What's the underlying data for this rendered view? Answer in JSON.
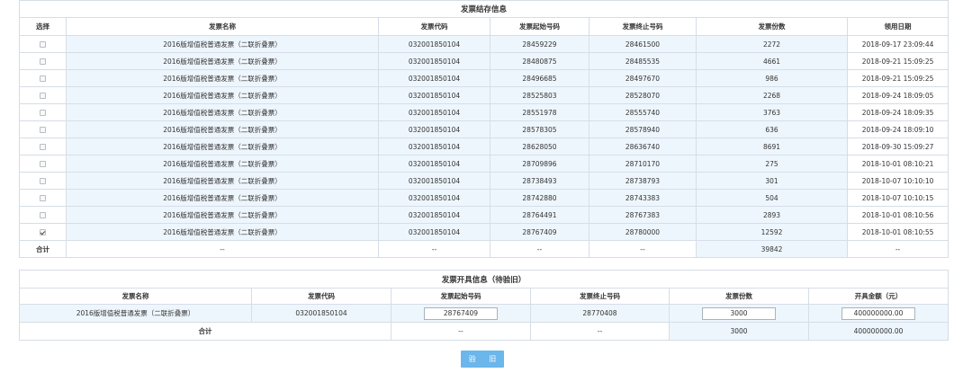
{
  "inventory": {
    "title": "发票结存信息",
    "headers": [
      "选择",
      "发票名称",
      "发票代码",
      "发票起始号码",
      "发票终止号码",
      "发票份数",
      "领用日期"
    ],
    "rows": [
      {
        "name": "2016版增值税普通发票（二联折叠票）",
        "code": "032001850104",
        "start": "28459229",
        "end": "28461500",
        "count": "2272",
        "date": "2018-09-17 23:09:44",
        "checked": false
      },
      {
        "name": "2016版增值税普通发票（二联折叠票）",
        "code": "032001850104",
        "start": "28480875",
        "end": "28485535",
        "count": "4661",
        "date": "2018-09-21 15:09:25",
        "checked": false
      },
      {
        "name": "2016版增值税普通发票（二联折叠票）",
        "code": "032001850104",
        "start": "28496685",
        "end": "28497670",
        "count": "986",
        "date": "2018-09-21 15:09:25",
        "checked": false
      },
      {
        "name": "2016版增值税普通发票（二联折叠票）",
        "code": "032001850104",
        "start": "28525803",
        "end": "28528070",
        "count": "2268",
        "date": "2018-09-24 18:09:05",
        "checked": false
      },
      {
        "name": "2016版增值税普通发票（二联折叠票）",
        "code": "032001850104",
        "start": "28551978",
        "end": "28555740",
        "count": "3763",
        "date": "2018-09-24 18:09:35",
        "checked": false
      },
      {
        "name": "2016版增值税普通发票（二联折叠票）",
        "code": "032001850104",
        "start": "28578305",
        "end": "28578940",
        "count": "636",
        "date": "2018-09-24 18:09:10",
        "checked": false
      },
      {
        "name": "2016版增值税普通发票（二联折叠票）",
        "code": "032001850104",
        "start": "28628050",
        "end": "28636740",
        "count": "8691",
        "date": "2018-09-30 15:09:27",
        "checked": false
      },
      {
        "name": "2016版增值税普通发票（二联折叠票）",
        "code": "032001850104",
        "start": "28709896",
        "end": "28710170",
        "count": "275",
        "date": "2018-10-01 08:10:21",
        "checked": false
      },
      {
        "name": "2016版增值税普通发票（二联折叠票）",
        "code": "032001850104",
        "start": "28738493",
        "end": "28738793",
        "count": "301",
        "date": "2018-10-07 10:10:10",
        "checked": false
      },
      {
        "name": "2016版增值税普通发票（二联折叠票）",
        "code": "032001850104",
        "start": "28742880",
        "end": "28743383",
        "count": "504",
        "date": "2018-10-07 10:10:15",
        "checked": false
      },
      {
        "name": "2016版增值税普通发票（二联折叠票）",
        "code": "032001850104",
        "start": "28764491",
        "end": "28767383",
        "count": "2893",
        "date": "2018-10-01 08:10:56",
        "checked": false
      },
      {
        "name": "2016版增值税普通发票（二联折叠票）",
        "code": "032001850104",
        "start": "28767409",
        "end": "28780000",
        "count": "12592",
        "date": "2018-10-01 08:10:55",
        "checked": true
      }
    ],
    "total": {
      "label": "合计",
      "name": "--",
      "code": "--",
      "start": "--",
      "end": "--",
      "count": "39842",
      "date": "--"
    }
  },
  "issue": {
    "title": "发票开具信息（待验旧）",
    "headers": [
      "发票名称",
      "发票代码",
      "发票起始号码",
      "发票终止号码",
      "发票份数",
      "开具金额（元）"
    ],
    "row": {
      "name": "2016版增值税普通发票（二联折叠票）",
      "code": "032001850104",
      "start_input": "28767409",
      "end": "28770408",
      "count_input": "3000",
      "amount_input": "400000000.00"
    },
    "total": {
      "label": "合计",
      "start": "--",
      "end": "--",
      "count": "3000",
      "amount": "400000000.00"
    }
  },
  "verify_button": "验 旧"
}
